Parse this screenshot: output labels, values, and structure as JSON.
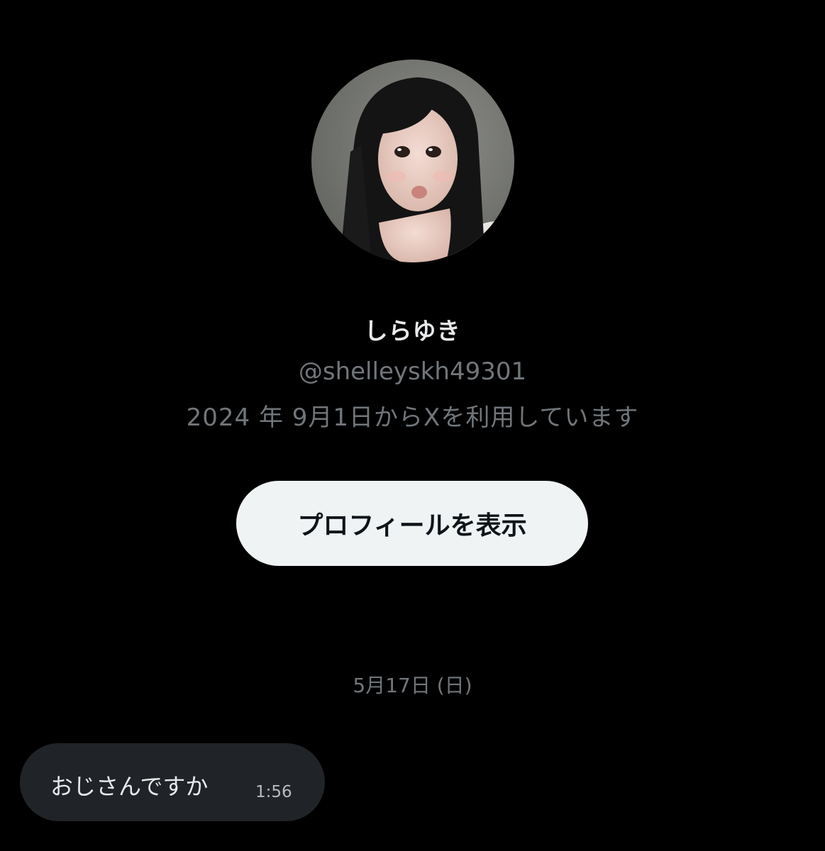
{
  "profile": {
    "avatar_icon": "user-avatar-photo",
    "display_name": "しらゆき",
    "handle": "@shelleyskh49301",
    "joined_text": "2024 年 9月1日からXを利用しています",
    "view_profile_label": "プロフィールを表示"
  },
  "messages": {
    "date_separator": "5月17日 (日)",
    "items": [
      {
        "text": "おじさんですか",
        "time": "1:56"
      }
    ]
  },
  "colors": {
    "background": "#000000",
    "primary_text": "#e7e9ea",
    "secondary_text": "#71767b",
    "button_bg": "#eff3f4",
    "button_text": "#0f1419",
    "bubble_bg": "#202327"
  }
}
